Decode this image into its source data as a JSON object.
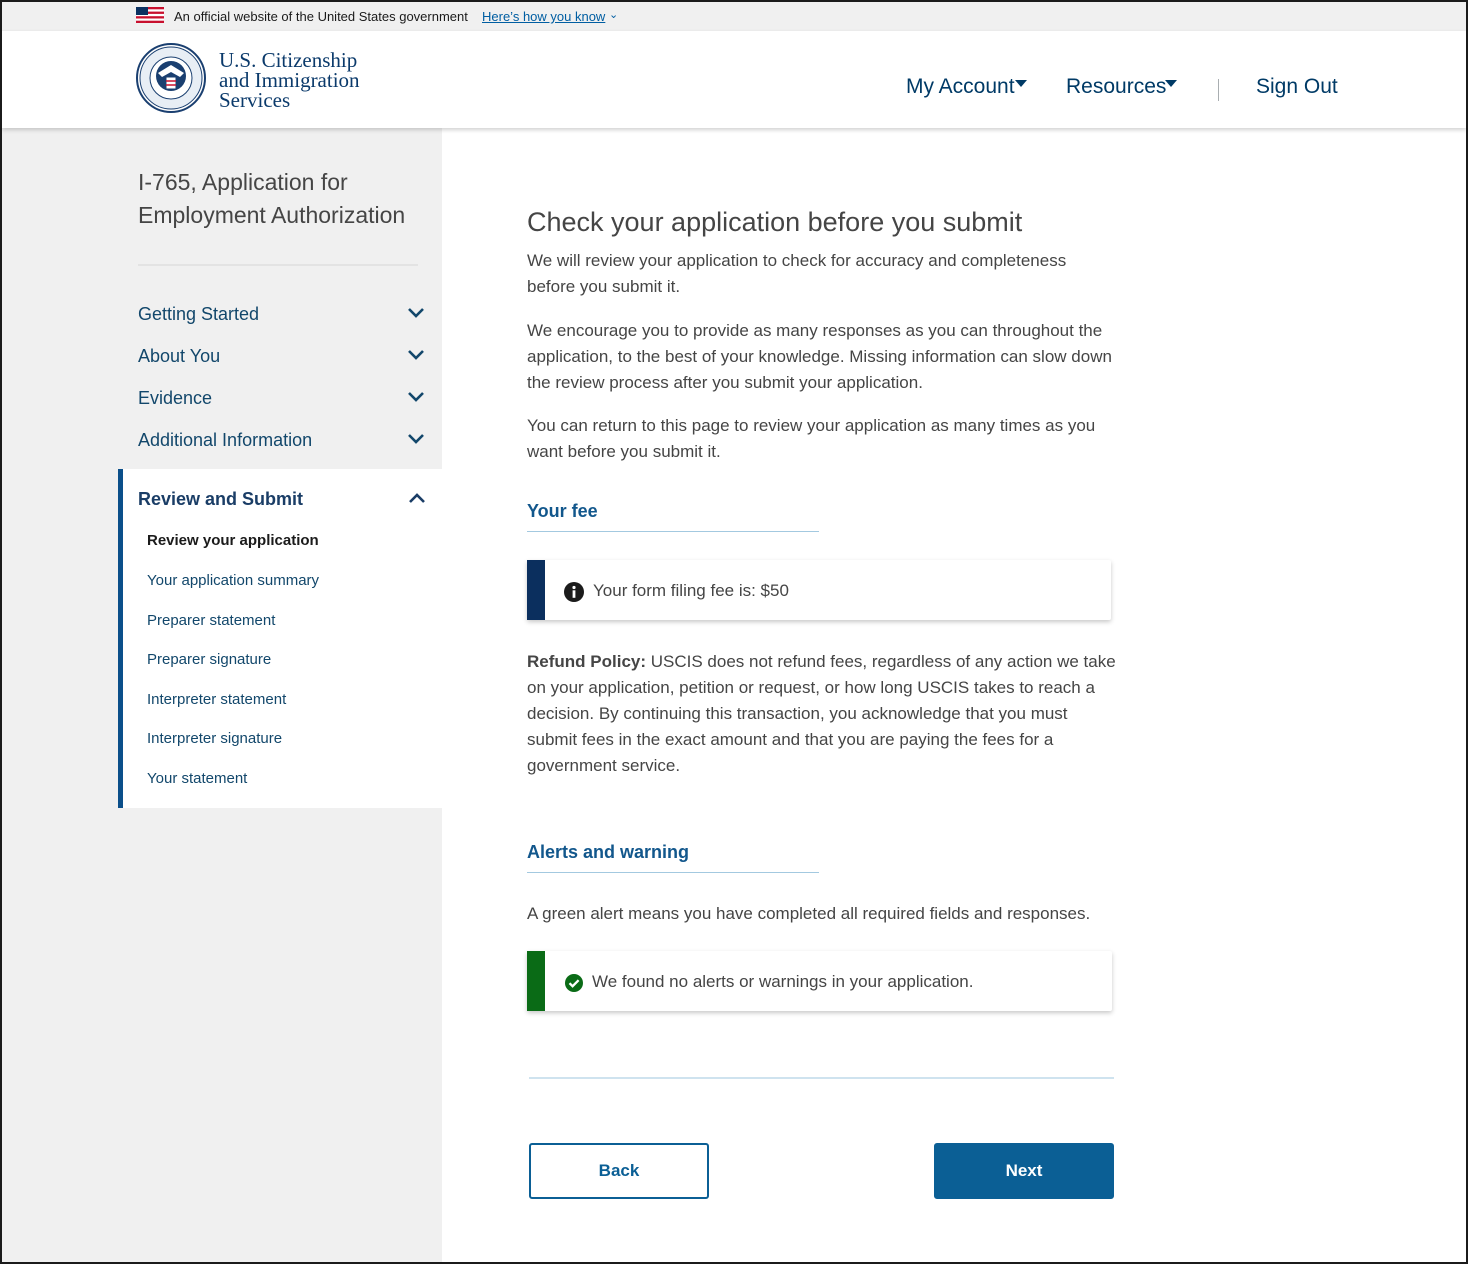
{
  "banner": {
    "official_text": "An official website of the United States government",
    "how_know_link": "Here’s how you know"
  },
  "header": {
    "brand_line1": "U.S. Citizenship",
    "brand_line2": "and Immigration",
    "brand_line3": "Services",
    "nav": {
      "my_account": "My Account",
      "resources": "Resources",
      "sign_out": "Sign Out"
    }
  },
  "sidebar": {
    "form_title": "I-765, Application for Employment Authorization",
    "sections": [
      {
        "label": "Getting Started"
      },
      {
        "label": "About You"
      },
      {
        "label": "Evidence"
      },
      {
        "label": "Additional Information"
      }
    ],
    "active_section": {
      "label": "Review and Submit",
      "items": [
        {
          "label": "Review your application"
        },
        {
          "label": "Your application summary"
        },
        {
          "label": "Preparer statement"
        },
        {
          "label": "Preparer signature"
        },
        {
          "label": "Interpreter statement"
        },
        {
          "label": "Interpreter signature"
        },
        {
          "label": "Your statement"
        }
      ]
    }
  },
  "main": {
    "title": "Check your application before you submit",
    "intro1": "We will review your application to check for accuracy and completeness before you submit it.",
    "intro2": "We encourage you to provide as many responses as you can throughout the application, to the best of your knowledge. Missing information can slow down the review process after you submit your application.",
    "intro3": "You can return to this page to review your application as many times as you want before you submit it.",
    "fee": {
      "heading": "Your fee",
      "alert_text": "Your form filing fee is: $50",
      "refund_label": "Refund Policy:",
      "refund_text": " USCIS does not refund fees, regardless of any action we take on your application, petition or request, or how long USCIS takes to reach a decision. By continuing this transaction, you acknowledge that you must submit fees in the exact amount and that you are paying the fees for a government service."
    },
    "alerts": {
      "heading": "Alerts and warning",
      "description": "A green alert means you have completed all required fields and responses.",
      "success_text": "We found no alerts or warnings in your application."
    },
    "buttons": {
      "back": "Back",
      "next": "Next"
    }
  },
  "colors": {
    "info_bar": "#0b2f5e",
    "success_bar": "#0a6b16",
    "primary": "#0b5f95"
  },
  "icons": {
    "flag": "us-flag-icon",
    "seal": "dhs-seal-icon",
    "chevron_down": "chevron-down-icon",
    "chevron_up": "chevron-up-icon",
    "info": "info-icon",
    "check": "check-circle-icon",
    "caret": "caret-down-icon"
  }
}
